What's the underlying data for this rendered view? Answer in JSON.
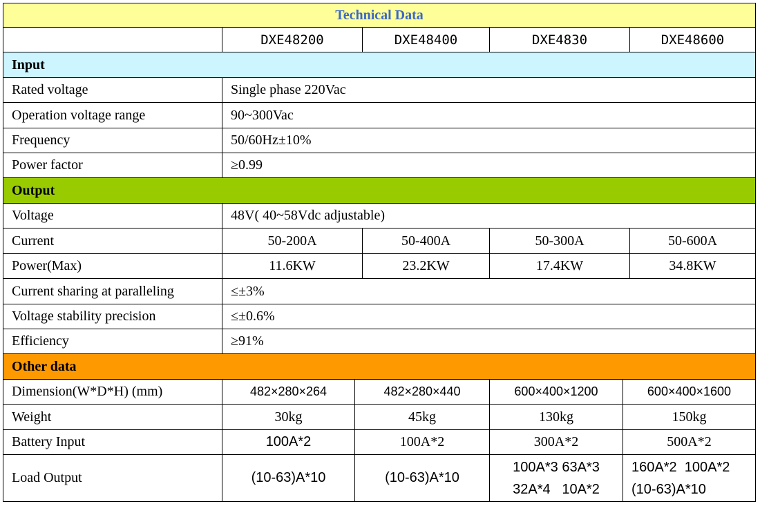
{
  "title": "Technical Data",
  "models": [
    "DXE48200",
    "DXE48400",
    "DXE4830",
    "DXE48600"
  ],
  "sections": {
    "input": "Input",
    "output": "Output",
    "other": "Other data"
  },
  "input": {
    "rated_voltage": {
      "label": "Rated voltage",
      "value": "Single phase 220Vac"
    },
    "op_range": {
      "label": "Operation voltage range",
      "value": "90~300Vac"
    },
    "frequency": {
      "label": "Frequency",
      "value": "50/60Hz±10%"
    },
    "power_factor": {
      "label": "Power factor",
      "value": "≥0.99"
    }
  },
  "output": {
    "voltage": {
      "label": "Voltage",
      "value": "48V( 40~58Vdc adjustable)"
    },
    "current": {
      "label": "Current",
      "values": [
        "50-200A",
        "50-400A",
        "50-300A",
        "50-600A"
      ]
    },
    "power": {
      "label": "Power(Max)",
      "values": [
        "11.6KW",
        "23.2KW",
        "17.4KW",
        "34.8KW"
      ]
    },
    "sharing": {
      "label": "Current sharing at paralleling",
      "value": "≤±3%"
    },
    "stability": {
      "label": "Voltage stability precision",
      "value": "≤±0.6%"
    },
    "efficiency": {
      "label": "Efficiency",
      "value": "≥91%"
    }
  },
  "other": {
    "dimension": {
      "label": "Dimension(W*D*H) (mm)",
      "values": [
        "482×280×264",
        "482×280×440",
        "600×400×1200",
        "600×400×1600"
      ]
    },
    "weight": {
      "label": "Weight",
      "values": [
        "30kg",
        "45kg",
        "130kg",
        "150kg"
      ]
    },
    "battery": {
      "label": "Battery Input",
      "values": [
        "100A*2",
        "100A*2",
        "300A*2",
        "500A*2"
      ]
    },
    "load": {
      "label": "Load Output",
      "values": [
        "(10-63)A*10",
        "(10-63)A*10"
      ],
      "col3": [
        "100A*3 63A*3",
        "32A*4   10A*2"
      ],
      "col4": [
        "160A*2  100A*2",
        "(10-63)A*10"
      ]
    }
  }
}
